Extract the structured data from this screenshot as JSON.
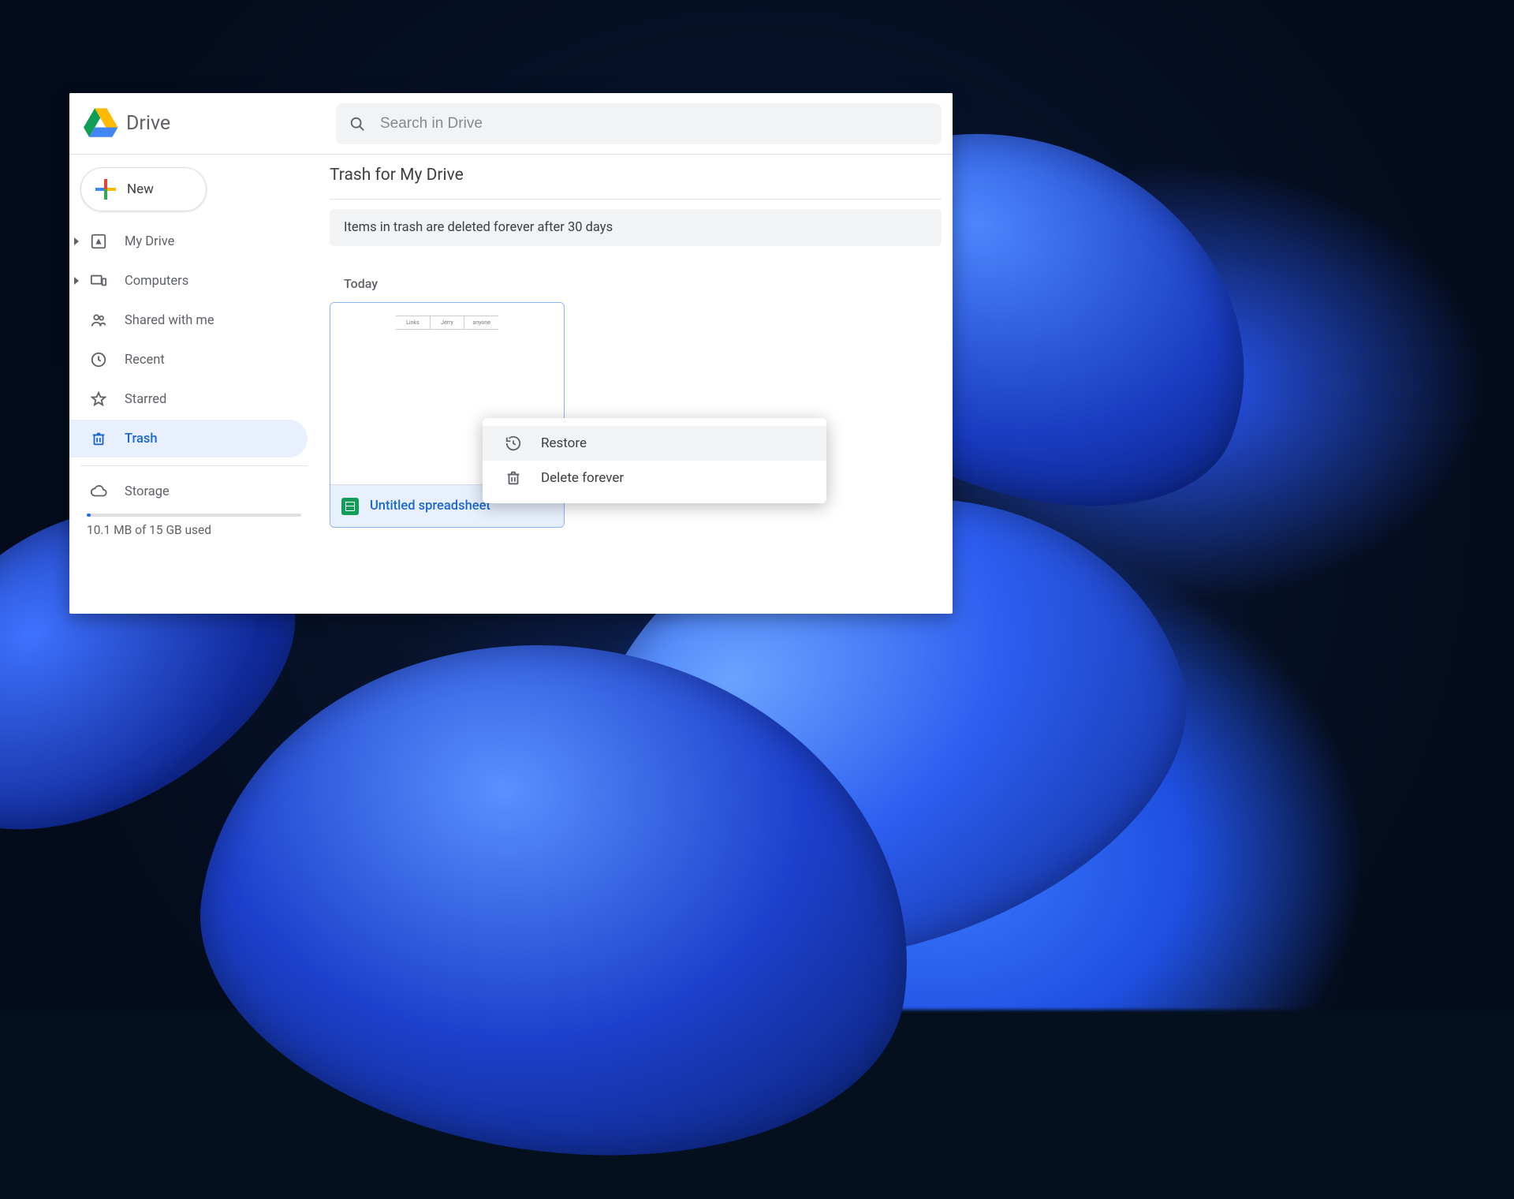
{
  "app_name": "Drive",
  "search": {
    "placeholder": "Search in Drive"
  },
  "new_button_label": "New",
  "sidebar": {
    "items": [
      {
        "label": "My Drive",
        "icon": "drive-box-icon",
        "expandable": true,
        "active": false
      },
      {
        "label": "Computers",
        "icon": "devices-icon",
        "expandable": true,
        "active": false
      },
      {
        "label": "Shared with me",
        "icon": "people-icon",
        "expandable": false,
        "active": false
      },
      {
        "label": "Recent",
        "icon": "clock-icon",
        "expandable": false,
        "active": false
      },
      {
        "label": "Starred",
        "icon": "star-icon",
        "expandable": false,
        "active": false
      },
      {
        "label": "Trash",
        "icon": "trash-icon",
        "expandable": false,
        "active": true
      }
    ],
    "storage_label": "Storage",
    "storage_usage_text": "10.1 MB of 15 GB used"
  },
  "main": {
    "title": "Trash for My Drive",
    "banner": "Items in trash are deleted forever after 30 days",
    "section_label": "Today",
    "file": {
      "name": "Untitled spreadsheet"
    }
  },
  "context_menu": {
    "items": [
      {
        "label": "Restore",
        "icon": "restore-icon"
      },
      {
        "label": "Delete forever",
        "icon": "trash-icon"
      }
    ],
    "hover_index": 0
  }
}
